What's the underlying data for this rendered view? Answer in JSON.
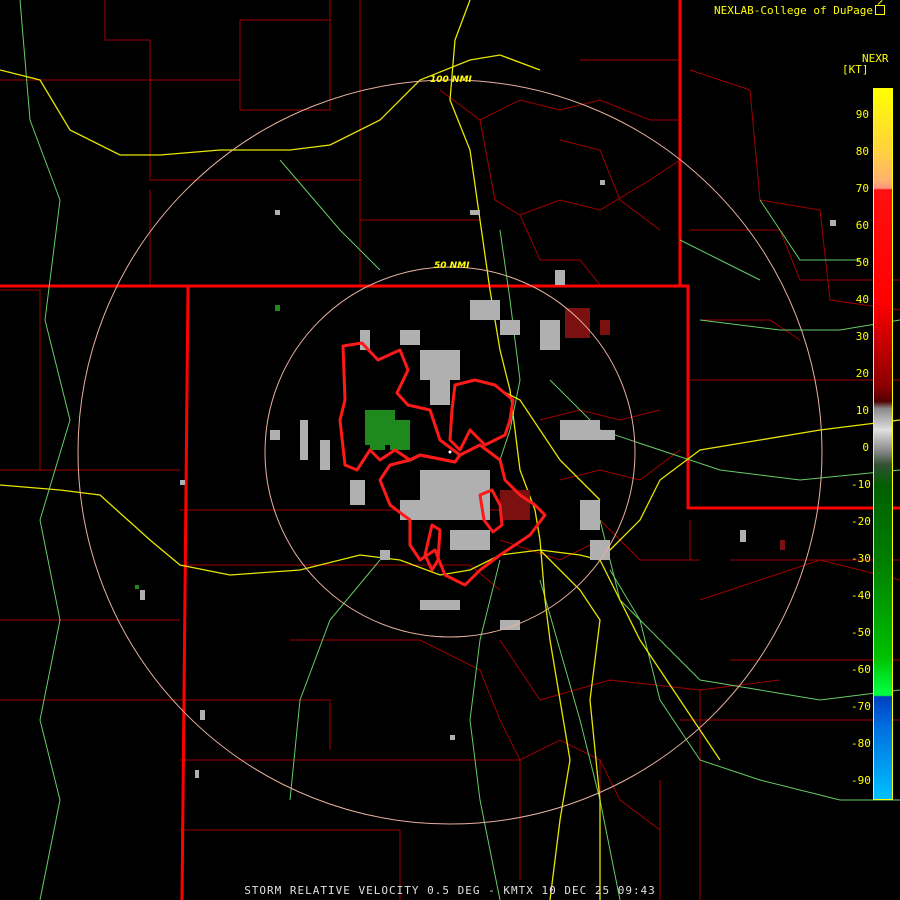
{
  "header": {
    "attribution": "NEXLAB-College of DuPage",
    "product": "NEXR",
    "unit": "[KT]"
  },
  "map": {
    "rings": [
      {
        "label": "100 NMI"
      },
      {
        "label": "50 NMI"
      }
    ]
  },
  "legend": {
    "ticks": [
      "90",
      "80",
      "70",
      "60",
      "50",
      "40",
      "30",
      "20",
      "10",
      "0",
      "-10",
      "-20",
      "-30",
      "-40",
      "-50",
      "-60",
      "-70",
      "-80",
      "-90"
    ]
  },
  "footer": {
    "caption": "STORM RELATIVE VELOCITY 0.5 DEG - KMTX 10 DEC 25 09:43"
  },
  "colors": {
    "state_border": "#ff0000",
    "county_border": "#a00000",
    "highway": "#e6e600",
    "road": "#66cc66",
    "range_ring": "#e8b0a0",
    "warning_polygon": "#ff1a1a",
    "label": "#ffff00"
  }
}
